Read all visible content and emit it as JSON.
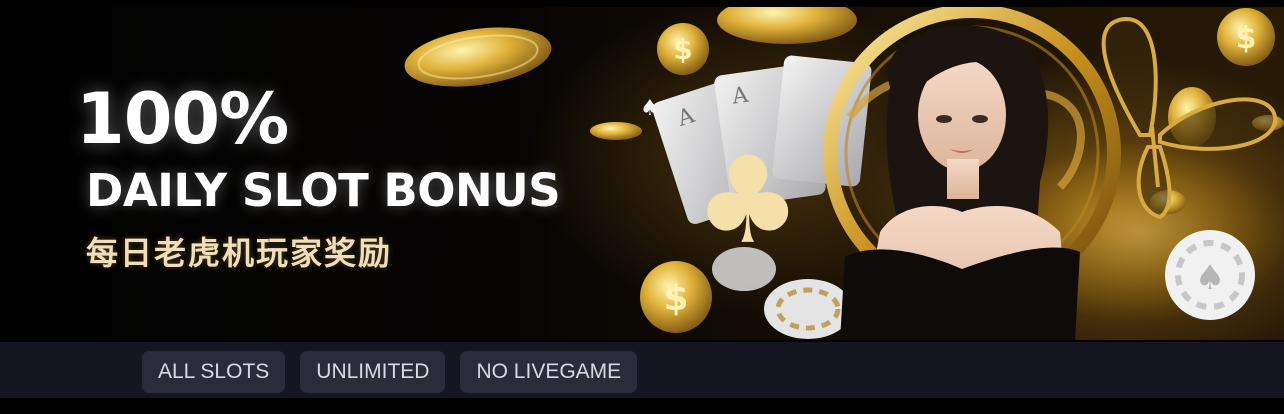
{
  "banner": {
    "headline_percent": "100%",
    "headline_title": "DAILY SLOT BONUS",
    "headline_subtitle": "每日老虎机玩家奖励"
  },
  "tags": [
    "ALL SLOTS",
    "UNLIMITED",
    "NO LIVEGAME"
  ],
  "colors": {
    "gold": "#d6a52c",
    "tag_background": "#2b2b39",
    "tag_text": "#d9d9e2",
    "tagbar_background": "#161622"
  },
  "icons": [
    "gold-coin-icon",
    "playing-card-icon",
    "club-suit-icon",
    "spade-suit-icon",
    "poker-chip-icon",
    "dragon-emblem-icon",
    "butterfly-ornament-icon"
  ]
}
